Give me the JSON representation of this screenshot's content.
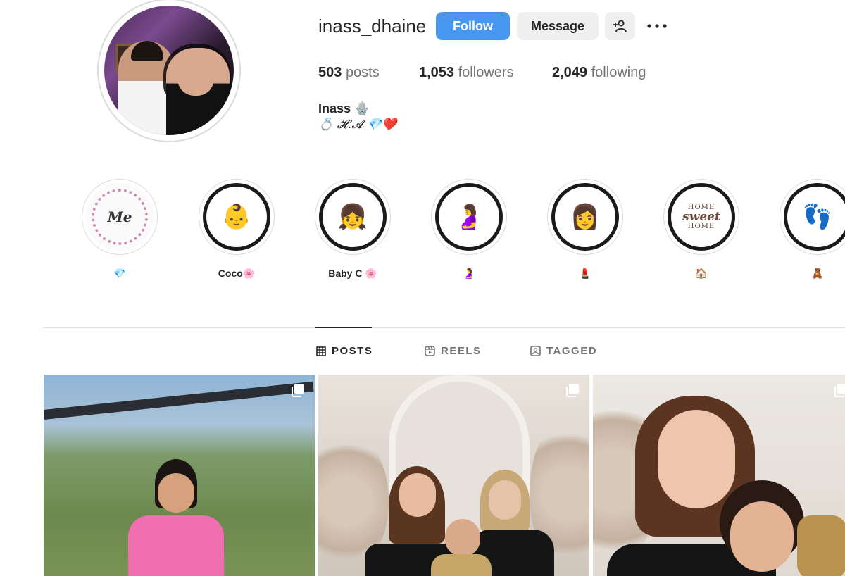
{
  "profile": {
    "username": "inass_dhaine",
    "follow_label": "Follow",
    "message_label": "Message",
    "stats": {
      "posts_count": "503",
      "posts_label": "posts",
      "followers_count": "1,053",
      "followers_label": "followers",
      "following_count": "2,049",
      "following_label": "following"
    },
    "bio_name": "Inass 🪬",
    "bio_line": "💍 𝓗.𝓐 💎❤️"
  },
  "highlights": [
    {
      "label": "💎",
      "cover": "Me"
    },
    {
      "label": "Coco🌸",
      "cover": "👶"
    },
    {
      "label": "Baby C 🌸",
      "cover": "👧"
    },
    {
      "label": "🤰",
      "cover": "🤰"
    },
    {
      "label": "💄",
      "cover": "👩"
    },
    {
      "label": "🏠",
      "cover_top": "HOME",
      "cover_mid": "sweet",
      "cover_bottom": "HOME"
    },
    {
      "label": "🧸",
      "cover": "👣"
    }
  ],
  "tabs": {
    "posts": "POSTS",
    "reels": "REELS",
    "tagged": "TAGGED"
  },
  "icons": {
    "add_user": "add-user-icon",
    "more": "more-icon",
    "grid": "grid-icon",
    "reels": "reels-icon",
    "tagged": "tagged-icon",
    "multi": "multiple-posts-icon"
  },
  "colors": {
    "follow_button": "#4796f0",
    "secondary_button": "#efefef",
    "text": "#262626",
    "muted": "#737373",
    "border": "#dbdbdb"
  }
}
